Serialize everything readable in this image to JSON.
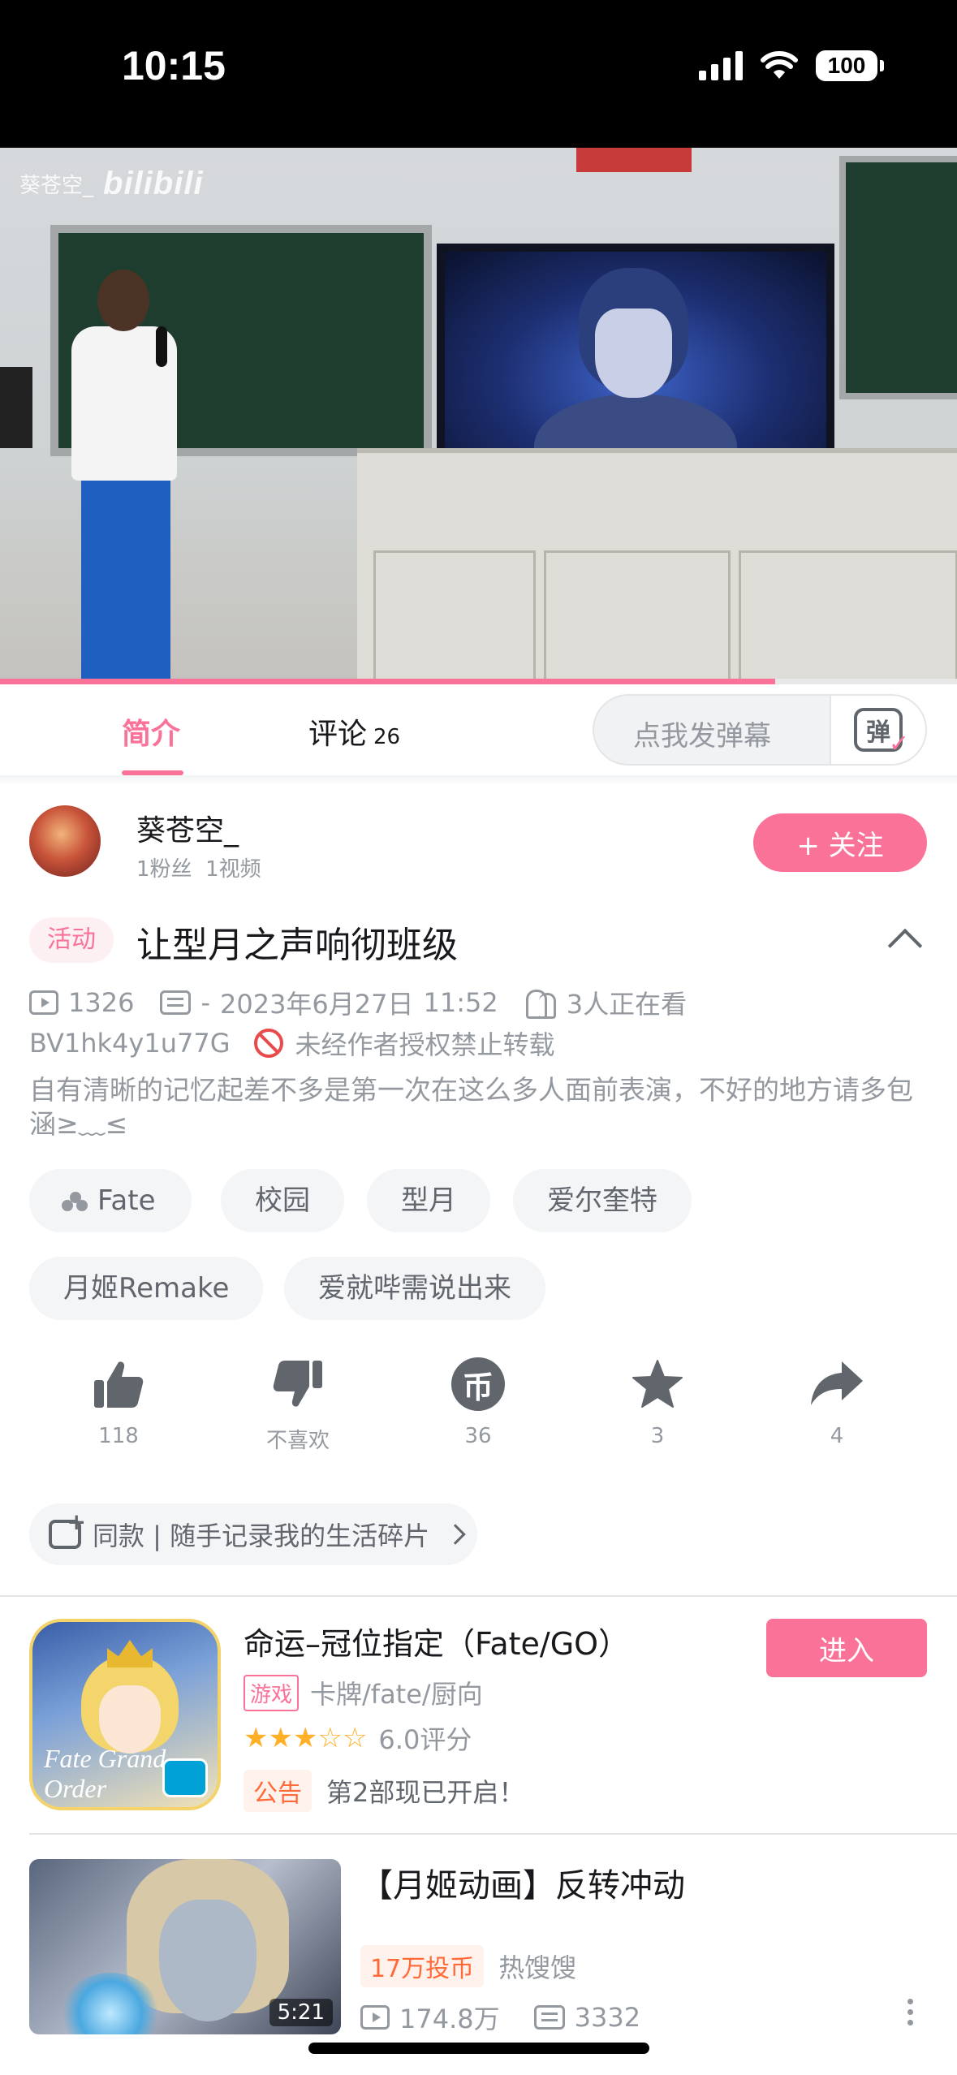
{
  "status_bar": {
    "time": "10:15",
    "battery": "100"
  },
  "video": {
    "watermark_user": "葵苍空_",
    "watermark_logo": "bilibili",
    "progress": 0.81
  },
  "tabs": {
    "intro": "简介",
    "comments": "评论",
    "comments_count": "26"
  },
  "danmaku": {
    "placeholder": "点我发弹幕",
    "icon_char": "弹"
  },
  "uploader": {
    "name": "葵苍空_",
    "fans": "1粉丝",
    "videos": "1视频",
    "follow_label": "+ 关注"
  },
  "title": {
    "activity_tag": "活动",
    "text": "让型月之声响彻班级"
  },
  "meta": {
    "views": "1326",
    "danmaku_count": "-",
    "date": "2023年6月27日",
    "time": "11:52",
    "watching": "3人正在看",
    "bvid": "BV1hk4y1u77G",
    "copyright": "未经作者授权禁止转载"
  },
  "description": "自有清晰的记忆起差不多是第一次在这么多人面前表演，不好的地方请多包涵≥﹏≤",
  "tags": [
    "Fate",
    "校园",
    "型月",
    "爱尔奎特",
    "月姬Remake",
    "爱就哔需说出来"
  ],
  "actions": {
    "like": "118",
    "dislike": "不喜欢",
    "coin": "36",
    "favorite": "3",
    "share": "4"
  },
  "note_pill": "同款 | 随手记录我的生活碎片",
  "game_card": {
    "title": "命运–冠位指定（Fate/GO）",
    "type_badge": "游戏",
    "type_text": "卡牌/fate/厨向",
    "rating": 3,
    "rating_max": 5,
    "rating_text": "6.0评分",
    "notice_badge": "公告",
    "notice_text": "第2部现已开启！",
    "enter_label": "进入",
    "icon_text": "Fate Grand Order"
  },
  "recommended": {
    "title": "【月姬动画】反转冲动",
    "duration": "5:21",
    "coin_badge": "17万投币",
    "author": "热馊馊",
    "views": "174.8万",
    "danmaku": "3332"
  },
  "colors": {
    "accent": "#fb7299",
    "text": "#18191c",
    "muted": "#9499a0",
    "star": "#ffb027"
  }
}
